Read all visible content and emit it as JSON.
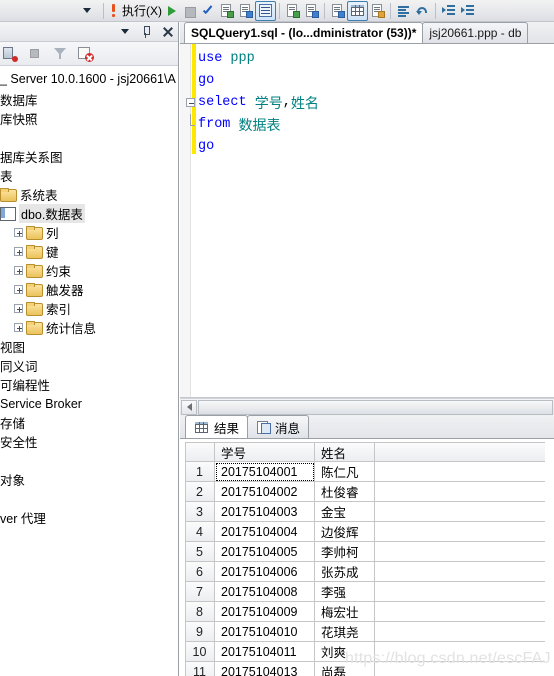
{
  "toolbar": {
    "execute_label": "执行(X)",
    "icons": [
      "dropdown-icon",
      "exclamation-icon",
      "play-icon",
      "stop-icon",
      "check-icon",
      "parse-icon",
      "display-estimated-plan-icon",
      "results-to-text-icon",
      "include-actual-plan-icon",
      "client-statistics-icon",
      "results-to-grid-icon",
      "results-to-file-icon",
      "results-to-text2-icon",
      "comment-icon",
      "uncomment-icon",
      "decrease-indent-icon",
      "increase-indent-icon"
    ]
  },
  "object_explorer": {
    "header_buttons": [
      "dropdown-icon",
      "pin-icon",
      "close-icon"
    ],
    "toolbar_icons": [
      "connect-icon",
      "disconnect-icon",
      "filter-icon",
      "stop-refresh-icon"
    ],
    "server_node": "_ Server 10.0.1600 - jsj20661\\A",
    "tree": [
      {
        "label": "数据库",
        "type": "text",
        "indent": 0
      },
      {
        "label": "库快照",
        "type": "text",
        "indent": 0
      },
      {
        "label": "",
        "type": "blank",
        "indent": 0
      },
      {
        "label": "据库关系图",
        "type": "text",
        "indent": 0
      },
      {
        "label": "表",
        "type": "text",
        "indent": 0
      },
      {
        "label": "系统表",
        "type": "folder",
        "indent": 0
      },
      {
        "label": "dbo.数据表",
        "type": "table",
        "indent": 0,
        "selected": true
      },
      {
        "label": "列",
        "type": "folder",
        "indent": 1,
        "expandable": true
      },
      {
        "label": "键",
        "type": "folder",
        "indent": 1,
        "expandable": true
      },
      {
        "label": "约束",
        "type": "folder",
        "indent": 1,
        "expandable": true
      },
      {
        "label": "触发器",
        "type": "folder",
        "indent": 1,
        "expandable": true
      },
      {
        "label": "索引",
        "type": "folder",
        "indent": 1,
        "expandable": true
      },
      {
        "label": "统计信息",
        "type": "folder",
        "indent": 1,
        "expandable": true
      },
      {
        "label": "视图",
        "type": "text",
        "indent": 0
      },
      {
        "label": "同义词",
        "type": "text",
        "indent": 0
      },
      {
        "label": "可编程性",
        "type": "text",
        "indent": 0
      },
      {
        "label": "Service Broker",
        "type": "text",
        "indent": 0
      },
      {
        "label": "存储",
        "type": "text",
        "indent": 0
      },
      {
        "label": "安全性",
        "type": "text",
        "indent": 0
      },
      {
        "label": "",
        "type": "blank",
        "indent": 0
      },
      {
        "label": "对象",
        "type": "text",
        "indent": 0
      },
      {
        "label": "",
        "type": "blank",
        "indent": 0
      },
      {
        "label": "ver 代理",
        "type": "text",
        "indent": 0
      }
    ]
  },
  "editor": {
    "tabs": [
      {
        "label": "SQLQuery1.sql - (lo...dministrator (53))*",
        "active": true
      },
      {
        "label": "jsj20661.ppp - db",
        "active": false
      }
    ],
    "lines": [
      {
        "tokens": [
          {
            "t": "use",
            "c": "kw"
          },
          {
            "t": " ",
            "c": "pun"
          },
          {
            "t": "ppp",
            "c": "tealw"
          }
        ]
      },
      {
        "tokens": [
          {
            "t": "go",
            "c": "kw"
          }
        ]
      },
      {
        "fold": "start",
        "tokens": [
          {
            "t": "select",
            "c": "kw"
          },
          {
            "t": " ",
            "c": "pun"
          },
          {
            "t": "学号",
            "c": "cjk"
          },
          {
            "t": ",",
            "c": "pun"
          },
          {
            "t": "姓名",
            "c": "cjk"
          }
        ]
      },
      {
        "fold": "end",
        "tokens": [
          {
            "t": "from",
            "c": "kw"
          },
          {
            "t": " ",
            "c": "pun"
          },
          {
            "t": "数据表",
            "c": "cjk"
          }
        ]
      },
      {
        "tokens": [
          {
            "t": "go",
            "c": "kw"
          }
        ]
      }
    ]
  },
  "results": {
    "tabs": [
      {
        "label": "结果",
        "icon": "grid-icon",
        "active": true
      },
      {
        "label": "消息",
        "icon": "message-icon",
        "active": false
      }
    ],
    "columns": [
      "",
      "学号",
      "姓名"
    ],
    "rows": [
      {
        "n": "1",
        "id": "20175104001",
        "name": "陈仁凡"
      },
      {
        "n": "2",
        "id": "20175104002",
        "name": "杜俊睿"
      },
      {
        "n": "3",
        "id": "20175104003",
        "name": "金宝"
      },
      {
        "n": "4",
        "id": "20175104004",
        "name": "边俊辉"
      },
      {
        "n": "5",
        "id": "20175104005",
        "name": "李帅柯"
      },
      {
        "n": "6",
        "id": "20175104006",
        "name": "张苏成"
      },
      {
        "n": "7",
        "id": "20175104008",
        "name": "李强"
      },
      {
        "n": "8",
        "id": "20175104009",
        "name": "梅宏壮"
      },
      {
        "n": "9",
        "id": "20175104010",
        "name": "花琪尧"
      },
      {
        "n": "10",
        "id": "20175104011",
        "name": "刘爽"
      },
      {
        "n": "11",
        "id": "20175104013",
        "name": "尚磊"
      }
    ]
  },
  "watermark": "https://blog.csdn.net/escFAJ"
}
